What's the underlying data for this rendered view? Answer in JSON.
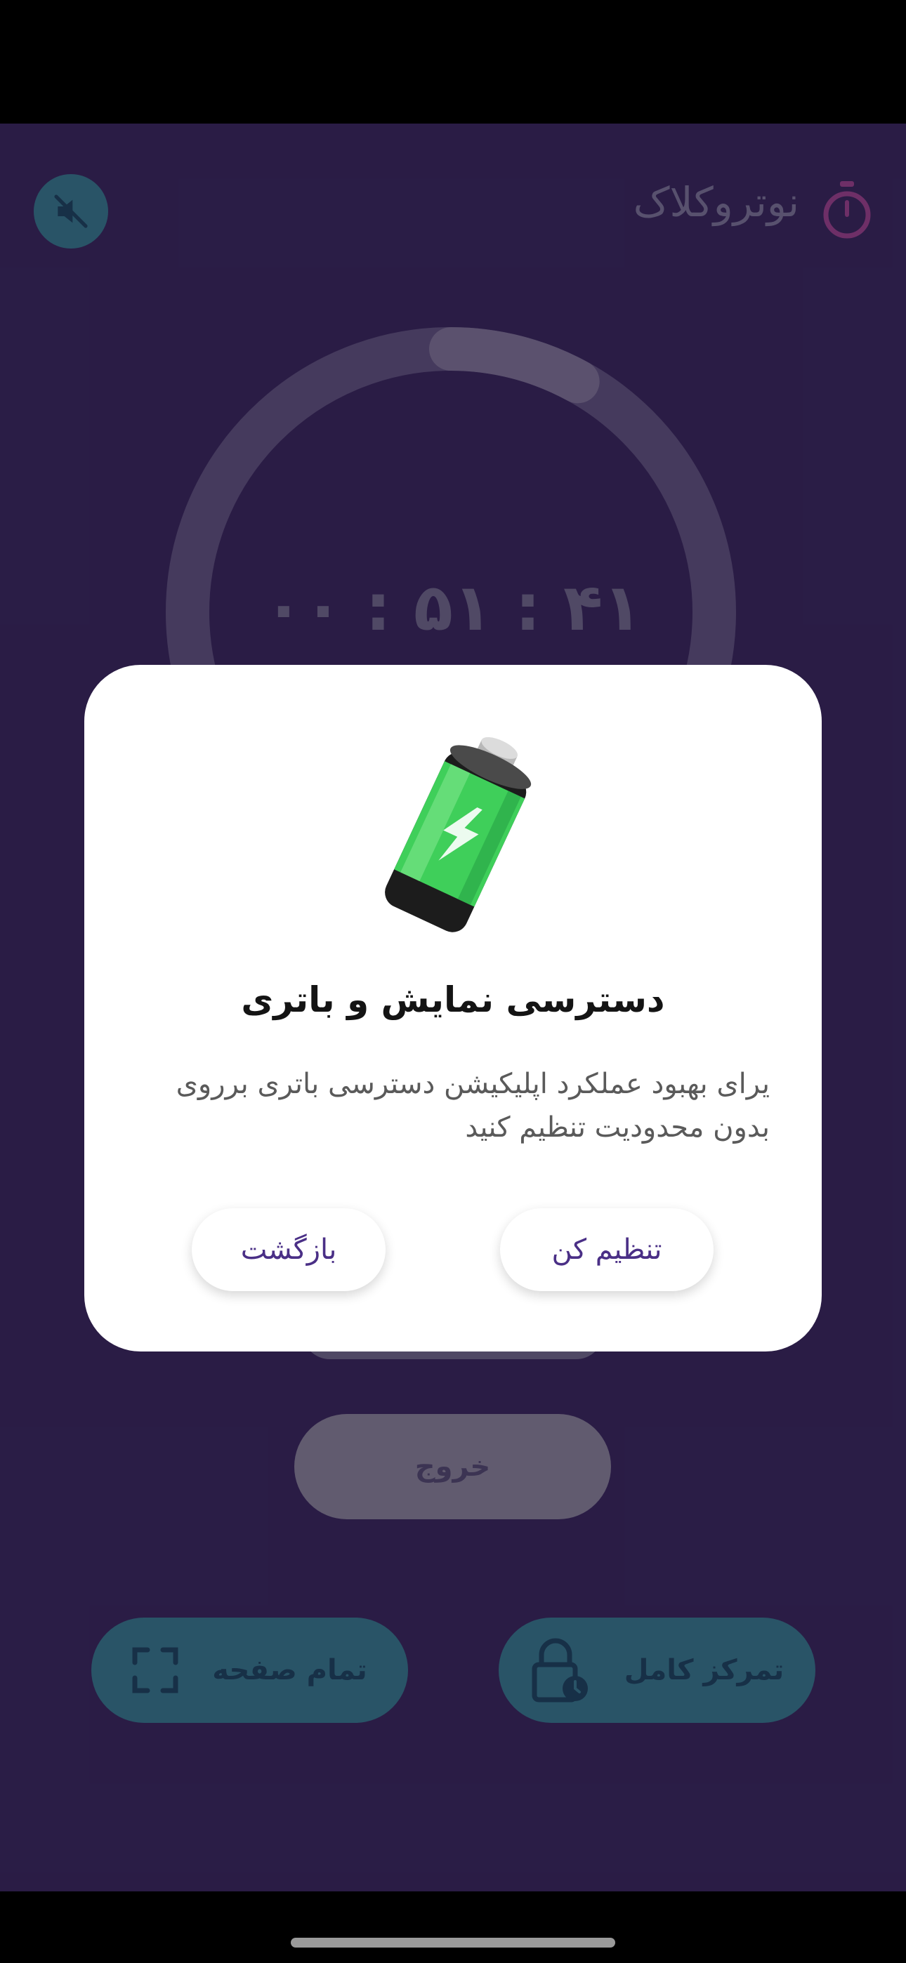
{
  "header": {
    "app_title": "نوتروکلاک",
    "timer_icon": "stopwatch-icon",
    "mute_icon": "speaker-muted-icon"
  },
  "timer": {
    "display": "۰۰ : ۵۱ : ۴۱",
    "progress": 0.08
  },
  "controls": {
    "exit_label": "خروج",
    "fullscreen_label": "تمام صفحه",
    "fullscreen_icon": "fullscreen-corners-icon",
    "focus_label": "تمرکز کامل",
    "focus_icon": "lock-clock-icon"
  },
  "dialog": {
    "image": "battery-charging-icon",
    "title": "دسترسی نمایش و باتری",
    "body": "یرای بهبود عملکرد اپلیکیشن دسترسی باتری برروی بدون محدودیت تنظیم کنید",
    "confirm_label": "تنظیم کن",
    "back_label": "بازگشت"
  },
  "colors": {
    "background": "#3b2a60",
    "accent_teal": "#3a8a9a",
    "button_text": "#4a2f86",
    "battery_green": "#3fcf5a"
  }
}
